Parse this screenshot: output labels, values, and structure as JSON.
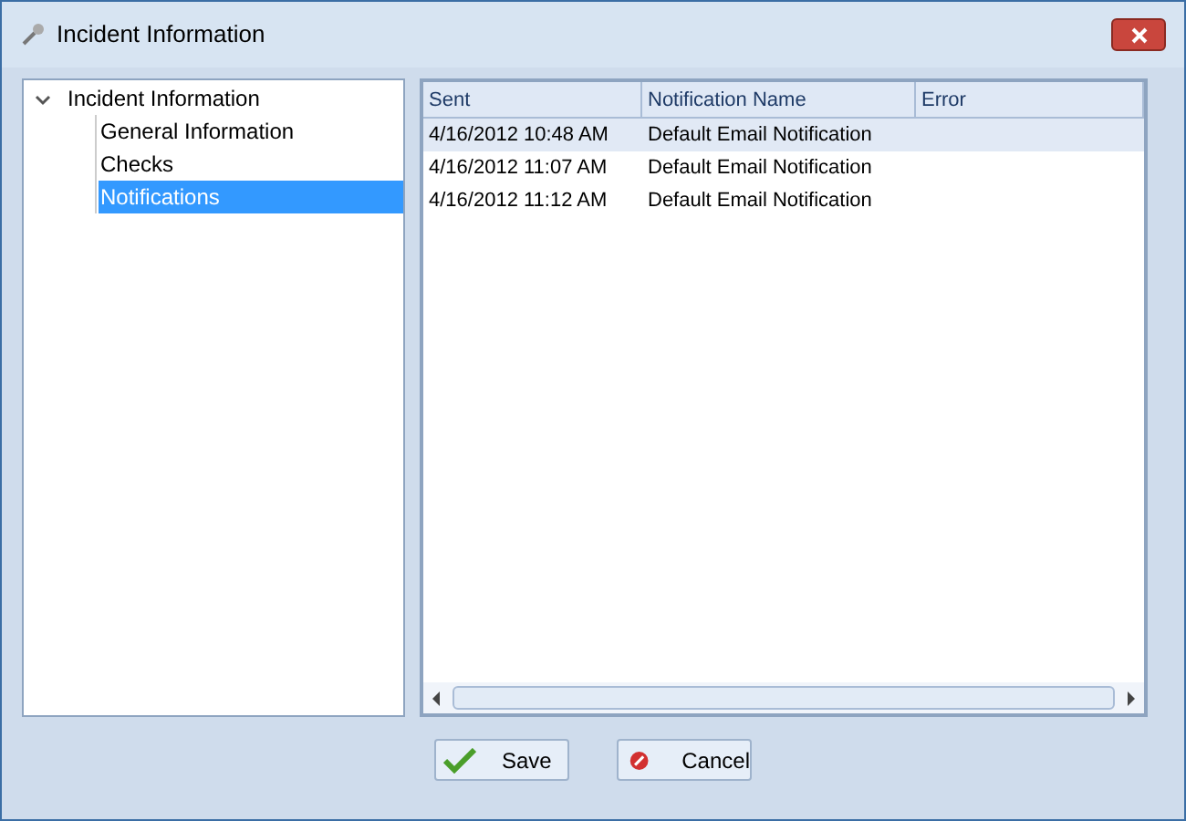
{
  "window": {
    "title": "Incident Information"
  },
  "tree": [
    {
      "label": "Incident Information",
      "expanded": true,
      "selected": false,
      "children": [
        {
          "label": "General Information",
          "selected": false
        },
        {
          "label": "Checks",
          "selected": false
        },
        {
          "label": "Notifications",
          "selected": true
        }
      ]
    }
  ],
  "table": {
    "columns": [
      "Sent",
      "Notification Name",
      "Error"
    ],
    "rows": [
      {
        "cells": [
          "4/16/2012 10:48 AM",
          "Default Email Notification"
        ],
        "selected": true
      },
      {
        "cells": [
          "4/16/2012 11:07 AM",
          "Default Email Notification"
        ],
        "selected": false
      },
      {
        "cells": [
          "4/16/2012 11:12 AM",
          "Default Email Notification"
        ],
        "selected": false
      }
    ]
  },
  "buttons": [
    {
      "label": "Save",
      "kind": "save"
    },
    {
      "label": "Cancel",
      "kind": "cancel"
    }
  ]
}
